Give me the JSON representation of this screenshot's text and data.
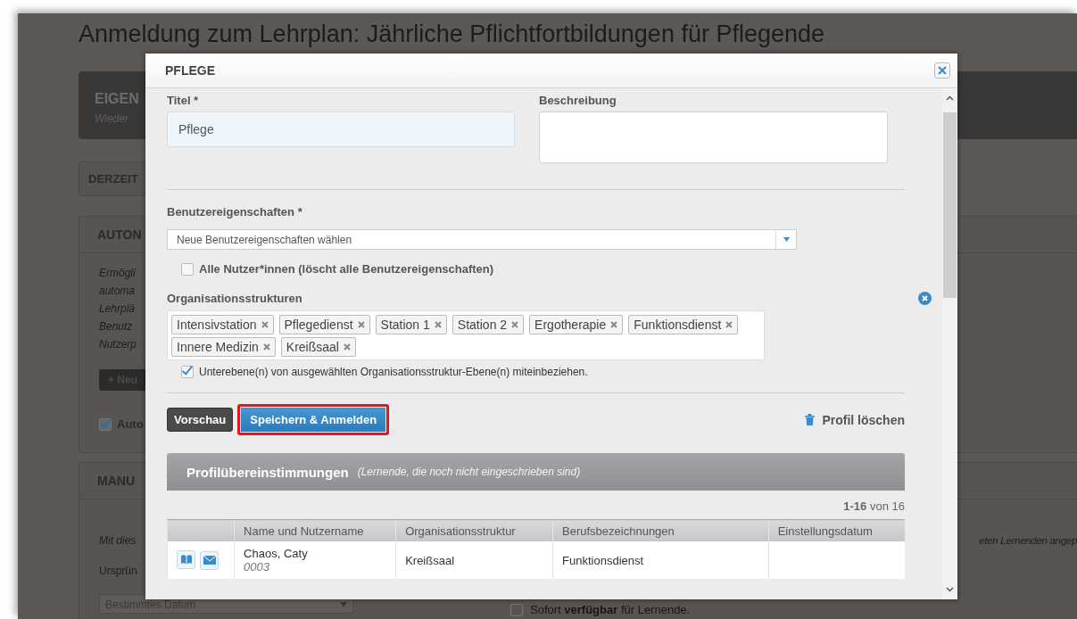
{
  "background_page": {
    "title": "Anmeldung zum Lehrplan: Jährliche Pflichtfortbildungen für Pflegende",
    "header_card": {
      "title": "EIGEN",
      "subtitle": "Wieder"
    },
    "current_button": "DERZEIT",
    "auto_panel": {
      "title": "AUTON",
      "description_lines": [
        "Ermögli",
        "automa",
        "Lehrplä",
        "Benutz",
        "Nutzerp"
      ],
      "new_button": "+ Neu",
      "checkbox": {
        "label": "Auto",
        "checked": true
      }
    },
    "manual_panel": {
      "title": "MANU",
      "description": "Mit dies",
      "right_text": "eten Lernenden angep",
      "origin_label": "Ursprün",
      "date_select": "Bestimmtes Datum",
      "available_checkbox": {
        "label": "Sofort **verfügbar** für Lernende.",
        "checked": false
      }
    }
  },
  "dialog": {
    "title": "PFLEGE",
    "title_field": {
      "label": "Titel *",
      "value": "Pflege"
    },
    "description_field": {
      "label": "Beschreibung"
    },
    "user_properties": {
      "label": "Benutzereigenschaften *",
      "placeholder": "Neue Benutzereigenschaften wählen"
    },
    "all_users_checkbox": {
      "label": "Alle Nutzer*innen (löscht alle Benutzereigenschaften)",
      "checked": false
    },
    "org_structures": {
      "label": "Organisationsstrukturen",
      "tags": [
        "Intensivstation",
        "Pflegedienst",
        "Station 1",
        "Station 2",
        "Ergotherapie",
        "Funktionsdienst",
        "Innere Medizin",
        "Kreißsaal"
      ]
    },
    "include_sublevels": {
      "label": "Unterebene(n) von ausgewählten Organisationsstruktur-Ebene(n) miteinbeziehen.",
      "checked": true
    },
    "preview_button": "Vorschau",
    "save_button": {
      "label": "Speichern & Anmelden",
      "highlighted": true
    },
    "delete_link": "Profil löschen",
    "matches": {
      "title": "Profilübereinstimmungen",
      "subtitle": "(Lernende, die noch nicht eingeschrieben sind)",
      "pagination": "**1-16** von 16",
      "columns": [
        "Name und Nutzername",
        "Organisationsstruktur",
        "Berufsbezeichnungen",
        "Einstellungsdatum"
      ],
      "rows": [
        {
          "name": "Chaos, Caty",
          "username": "0003",
          "org": "Kreißsaal",
          "job": "Funktionsdienst"
        }
      ]
    }
  }
}
